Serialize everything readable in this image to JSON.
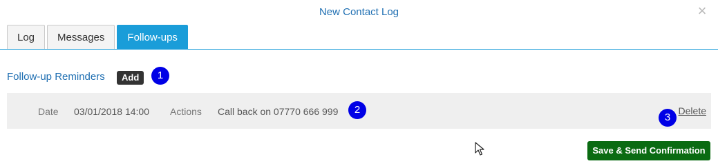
{
  "modal": {
    "title": "New Contact Log",
    "close_icon": "×"
  },
  "tabs": [
    {
      "label": "Log",
      "active": false
    },
    {
      "label": "Messages",
      "active": false
    },
    {
      "label": "Follow-ups",
      "active": true
    }
  ],
  "followups": {
    "heading": "Follow-up Reminders",
    "add_label": "Add",
    "reminders": [
      {
        "date_label": "Date",
        "date_value": "03/01/2018 14:00",
        "actions_label": "Actions",
        "actions_value": "Call back on 07770 666 999",
        "delete_label": "Delete"
      }
    ]
  },
  "footer": {
    "save_label": "Save & Send Confirmation"
  },
  "annotations": {
    "badge_1": "1",
    "badge_2": "2",
    "badge_3": "3"
  },
  "colors": {
    "accent": "#1a9dd9",
    "title": "#1f6fb2",
    "save_button": "#0a6b12",
    "badge": "#0000e6",
    "row_background": "#efefef"
  }
}
